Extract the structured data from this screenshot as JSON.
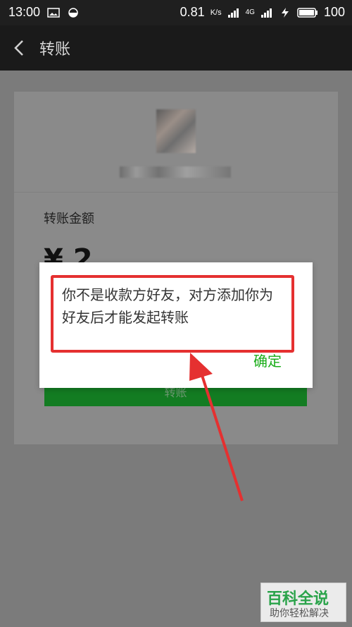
{
  "status_bar": {
    "time": "13:00",
    "speed": "0.81",
    "speed_unit": "K/s",
    "network": "4G",
    "battery": "100"
  },
  "nav": {
    "title": "转账"
  },
  "transfer": {
    "amount_label": "转账金额",
    "amount_value": "¥ 2",
    "button_label": "转账"
  },
  "dialog": {
    "message": "你不是收款方好友，对方添加你为好友后才能发起转账",
    "confirm_label": "确定"
  },
  "watermark": {
    "title": "百科全说",
    "subtitle": "助你轻松解决"
  },
  "colors": {
    "accent_green": "#1aad19",
    "highlight_red": "#e53030"
  },
  "icons": {
    "status_left": [
      "image-icon",
      "do-not-disturb-icon"
    ],
    "status_right": [
      "signal-icon",
      "4g-signal-icon",
      "flash-icon",
      "battery-icon"
    ],
    "nav": "back-arrow-icon"
  }
}
